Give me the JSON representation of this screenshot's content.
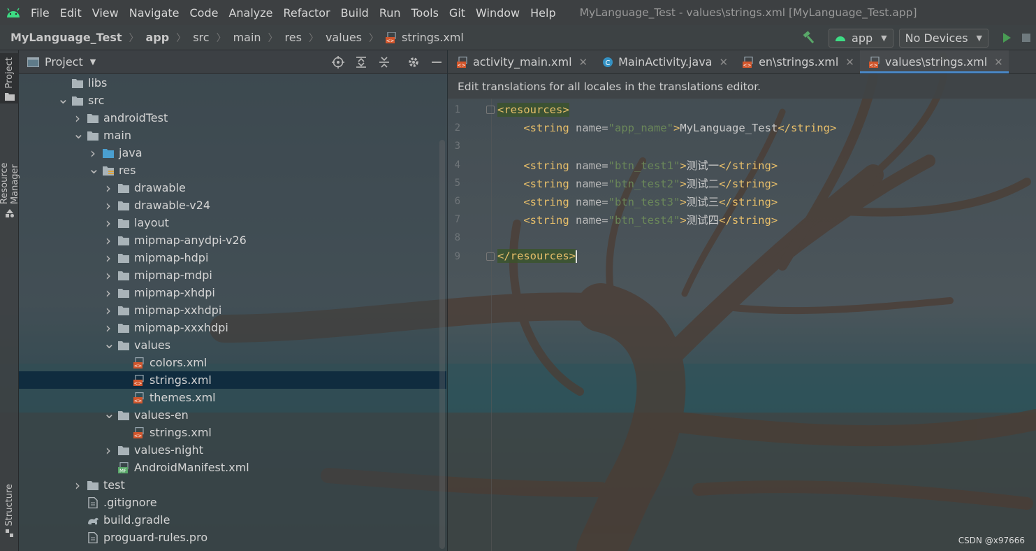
{
  "menubar": {
    "items": [
      "File",
      "Edit",
      "View",
      "Navigate",
      "Code",
      "Analyze",
      "Refactor",
      "Build",
      "Run",
      "Tools",
      "Git",
      "Window",
      "Help"
    ],
    "window_title": "MyLanguage_Test - values\\strings.xml [MyLanguage_Test.app]"
  },
  "breadcrumb": {
    "items": [
      "MyLanguage_Test",
      "app",
      "src",
      "main",
      "res",
      "values",
      "strings.xml"
    ]
  },
  "toolbar": {
    "config_label": "app",
    "device_label": "No Devices"
  },
  "leftstrip": {
    "project_label": "Project",
    "resource_manager_label": "Resource Manager",
    "structure_label": "Structure"
  },
  "project_panel": {
    "title": "Project",
    "tree": [
      {
        "label": "libs",
        "depth": 1,
        "arrow": "",
        "icon": "folder-icon"
      },
      {
        "label": "src",
        "depth": 1,
        "arrow": "down",
        "icon": "folder-icon"
      },
      {
        "label": "androidTest",
        "depth": 2,
        "arrow": "right",
        "icon": "folder-icon"
      },
      {
        "label": "main",
        "depth": 2,
        "arrow": "down",
        "icon": "folder-icon"
      },
      {
        "label": "java",
        "depth": 3,
        "arrow": "right",
        "icon": "source-folder-icon"
      },
      {
        "label": "res",
        "depth": 3,
        "arrow": "down",
        "icon": "resource-folder-icon"
      },
      {
        "label": "drawable",
        "depth": 4,
        "arrow": "right",
        "icon": "folder-icon"
      },
      {
        "label": "drawable-v24",
        "depth": 4,
        "arrow": "right",
        "icon": "folder-icon"
      },
      {
        "label": "layout",
        "depth": 4,
        "arrow": "right",
        "icon": "folder-icon"
      },
      {
        "label": "mipmap-anydpi-v26",
        "depth": 4,
        "arrow": "right",
        "icon": "folder-icon"
      },
      {
        "label": "mipmap-hdpi",
        "depth": 4,
        "arrow": "right",
        "icon": "folder-icon"
      },
      {
        "label": "mipmap-mdpi",
        "depth": 4,
        "arrow": "right",
        "icon": "folder-icon"
      },
      {
        "label": "mipmap-xhdpi",
        "depth": 4,
        "arrow": "right",
        "icon": "folder-icon"
      },
      {
        "label": "mipmap-xxhdpi",
        "depth": 4,
        "arrow": "right",
        "icon": "folder-icon"
      },
      {
        "label": "mipmap-xxxhdpi",
        "depth": 4,
        "arrow": "right",
        "icon": "folder-icon"
      },
      {
        "label": "values",
        "depth": 4,
        "arrow": "down",
        "icon": "folder-icon"
      },
      {
        "label": "colors.xml",
        "depth": 5,
        "arrow": "",
        "icon": "xml-file-icon"
      },
      {
        "label": "strings.xml",
        "depth": 5,
        "arrow": "",
        "icon": "xml-file-icon",
        "selected": true
      },
      {
        "label": "themes.xml",
        "depth": 5,
        "arrow": "",
        "icon": "xml-file-icon"
      },
      {
        "label": "values-en",
        "depth": 4,
        "arrow": "down",
        "icon": "folder-icon"
      },
      {
        "label": "strings.xml",
        "depth": 5,
        "arrow": "",
        "icon": "xml-file-icon"
      },
      {
        "label": "values-night",
        "depth": 4,
        "arrow": "right",
        "icon": "folder-icon"
      },
      {
        "label": "AndroidManifest.xml",
        "depth": 4,
        "arrow": "",
        "icon": "manifest-file-icon"
      },
      {
        "label": "test",
        "depth": 2,
        "arrow": "right",
        "icon": "folder-icon"
      },
      {
        "label": ".gitignore",
        "depth": 2,
        "arrow": "",
        "icon": "text-file-icon"
      },
      {
        "label": "build.gradle",
        "depth": 2,
        "arrow": "",
        "icon": "gradle-file-icon"
      },
      {
        "label": "proguard-rules.pro",
        "depth": 2,
        "arrow": "",
        "icon": "text-file-icon"
      }
    ]
  },
  "editor": {
    "tabs": [
      {
        "label": "activity_main.xml",
        "icon": "xml-file-icon",
        "active": false
      },
      {
        "label": "MainActivity.java",
        "icon": "java-class-icon",
        "active": false
      },
      {
        "label": "en\\strings.xml",
        "icon": "xml-file-icon",
        "active": false
      },
      {
        "label": "values\\strings.xml",
        "icon": "xml-file-icon",
        "active": true
      }
    ],
    "banner": "Edit translations for all locales in the translations editor.",
    "lines": [
      {
        "n": "1",
        "tokens": [
          [
            "tag-hl",
            "<resources>"
          ]
        ]
      },
      {
        "n": "2",
        "tokens": [
          [
            "plain",
            "    "
          ],
          [
            "tag",
            "<string "
          ],
          [
            "attr",
            "name="
          ],
          [
            "val",
            "\"app_name\""
          ],
          [
            "tag",
            ">"
          ],
          [
            "plain",
            "MyLanguage_Test"
          ],
          [
            "tag",
            "</string>"
          ]
        ]
      },
      {
        "n": "3",
        "tokens": []
      },
      {
        "n": "4",
        "tokens": [
          [
            "plain",
            "    "
          ],
          [
            "tag",
            "<string "
          ],
          [
            "attr",
            "name="
          ],
          [
            "val",
            "\"btn_test1\""
          ],
          [
            "tag",
            ">"
          ],
          [
            "plain",
            "测试一"
          ],
          [
            "tag",
            "</string>"
          ]
        ]
      },
      {
        "n": "5",
        "tokens": [
          [
            "plain",
            "    "
          ],
          [
            "tag",
            "<string "
          ],
          [
            "attr",
            "name="
          ],
          [
            "val",
            "\"btn_test2\""
          ],
          [
            "tag",
            ">"
          ],
          [
            "plain",
            "测试二"
          ],
          [
            "tag",
            "</string>"
          ]
        ]
      },
      {
        "n": "6",
        "tokens": [
          [
            "plain",
            "    "
          ],
          [
            "tag",
            "<string "
          ],
          [
            "attr",
            "name="
          ],
          [
            "val",
            "\"btn_test3\""
          ],
          [
            "tag",
            ">"
          ],
          [
            "plain",
            "测试三"
          ],
          [
            "tag",
            "</string>"
          ]
        ]
      },
      {
        "n": "7",
        "tokens": [
          [
            "plain",
            "    "
          ],
          [
            "tag",
            "<string "
          ],
          [
            "attr",
            "name="
          ],
          [
            "val",
            "\"btn_test4\""
          ],
          [
            "tag",
            ">"
          ],
          [
            "plain",
            "测试四"
          ],
          [
            "tag",
            "</string>"
          ]
        ]
      },
      {
        "n": "8",
        "tokens": []
      },
      {
        "n": "9",
        "tokens": [
          [
            "tag-hl",
            "</resources>"
          ]
        ]
      }
    ]
  },
  "watermark": "CSDN @x97666"
}
